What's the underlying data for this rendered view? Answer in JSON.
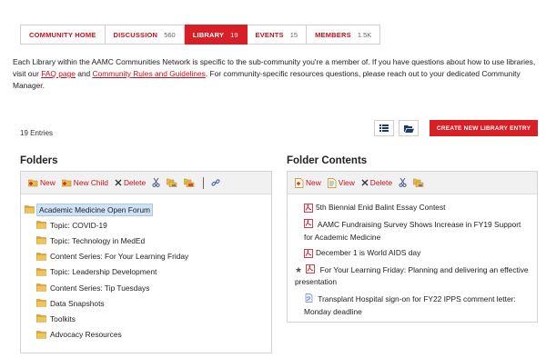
{
  "tabs": [
    {
      "label": "COMMUNITY HOME",
      "count": "",
      "active": false
    },
    {
      "label": "DISCUSSION",
      "count": "560",
      "active": false
    },
    {
      "label": "LIBRARY",
      "count": "19",
      "active": true
    },
    {
      "label": "EVENTS",
      "count": "15",
      "active": false
    },
    {
      "label": "MEMBERS",
      "count": "1.5K",
      "active": false
    }
  ],
  "intro": {
    "text_1": "Each Library within the AAMC Communities Network is specific to the sub-community you're a member of. If you have questions about how to use libraries, visit our ",
    "faq_link": "FAQ page",
    "text_2": " and ",
    "rules_link": "Community Rules and Guidelines",
    "text_3": ". For community-specific resources questions, please reach out to your dedicated Community Manager."
  },
  "entries_label": "19 Entries",
  "create_button": "CREATE NEW LIBRARY ENTRY",
  "folders": {
    "heading": "Folders",
    "toolbar": {
      "new": "New",
      "new_child": "New Child",
      "delete": "Delete"
    },
    "root": "Academic Medicine Open Forum",
    "items": [
      "Topic: COVID-19",
      "Topic: Technology in MedEd",
      "Content Series: For Your Learning Friday",
      "Topic: Leadership Development",
      "Content Series: Tip Tuesdays",
      "Data Snapshots",
      "Toolkits",
      "Advocacy Resources"
    ]
  },
  "contents": {
    "heading": "Folder Contents",
    "toolbar": {
      "new": "New",
      "view": "View",
      "delete": "Delete"
    },
    "files": [
      "5th Biennial Enid Balint Essay Contest",
      "AAMC Fundraising Survey Shows Increase in FY19 Support for Academic Medicine",
      "December 1 is World AIDS day",
      "For Your Learning Friday: Planning and delivering an effective presentation",
      "Transplant Hospital sign-on for FY22 IPPS comment letter: Monday deadline"
    ]
  },
  "colors": {
    "brand_red": "#d81f26",
    "link_red": "#c4121f",
    "selection": "#cfe3f7"
  }
}
